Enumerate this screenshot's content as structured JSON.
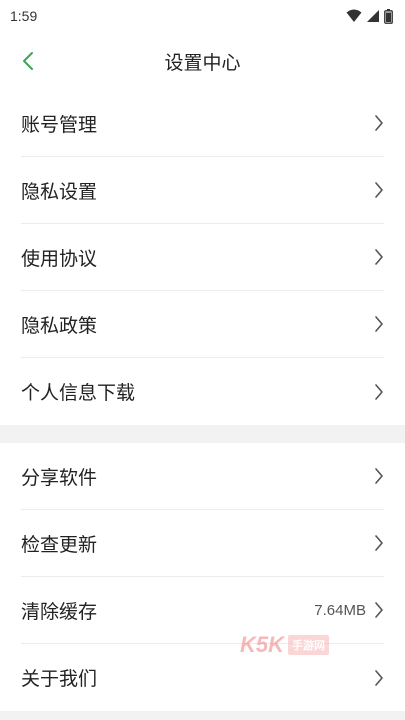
{
  "status_bar": {
    "time": "1:59"
  },
  "header": {
    "title": "设置中心",
    "back_icon": "chevron-left-icon",
    "accent_color": "#3aa457"
  },
  "sections": [
    {
      "items": [
        {
          "label": "账号管理"
        },
        {
          "label": "隐私设置"
        },
        {
          "label": "使用协议"
        },
        {
          "label": "隐私政策"
        },
        {
          "label": "个人信息下载"
        }
      ]
    },
    {
      "items": [
        {
          "label": "分享软件"
        },
        {
          "label": "检查更新"
        },
        {
          "label": "清除缓存",
          "value": "7.64MB"
        },
        {
          "label": "关于我们"
        }
      ]
    }
  ],
  "watermark": {
    "brand": "K5K",
    "tag": "手游网"
  }
}
